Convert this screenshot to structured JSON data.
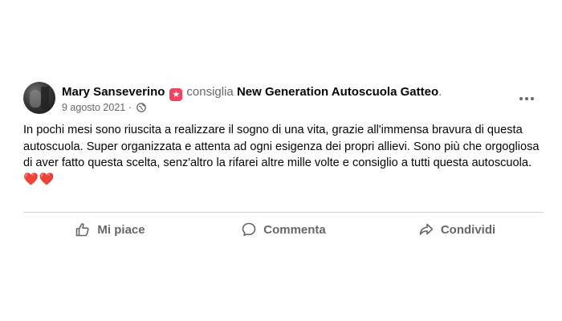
{
  "post": {
    "author": "Mary Sanseverino",
    "verb": "consiglia",
    "page": "New Generation Autoscuola Gatteo",
    "page_suffix": ".",
    "date": "9 agosto 2021",
    "date_separator": "·",
    "privacy_icon": "globe-icon",
    "badge_icon": "star-recommend-icon",
    "badge_color": "#f3425f",
    "text": "In pochi mesi sono riuscita a realizzare il sogno di una vita, grazie all'immensa bravura di questa autoscuola. Super organizzata e attenta ad ogni esigenza dei propri allievi. Sono più che orgogliosa di aver fatto questa scelta, senz'altro la rifarei altre mille volte e consiglio a tutti questa autoscuola.",
    "emoji": "❤️❤️",
    "more_icon": "more-options-icon"
  },
  "actions": {
    "like_label": "Mi piace",
    "comment_label": "Commenta",
    "share_label": "Condividi"
  }
}
